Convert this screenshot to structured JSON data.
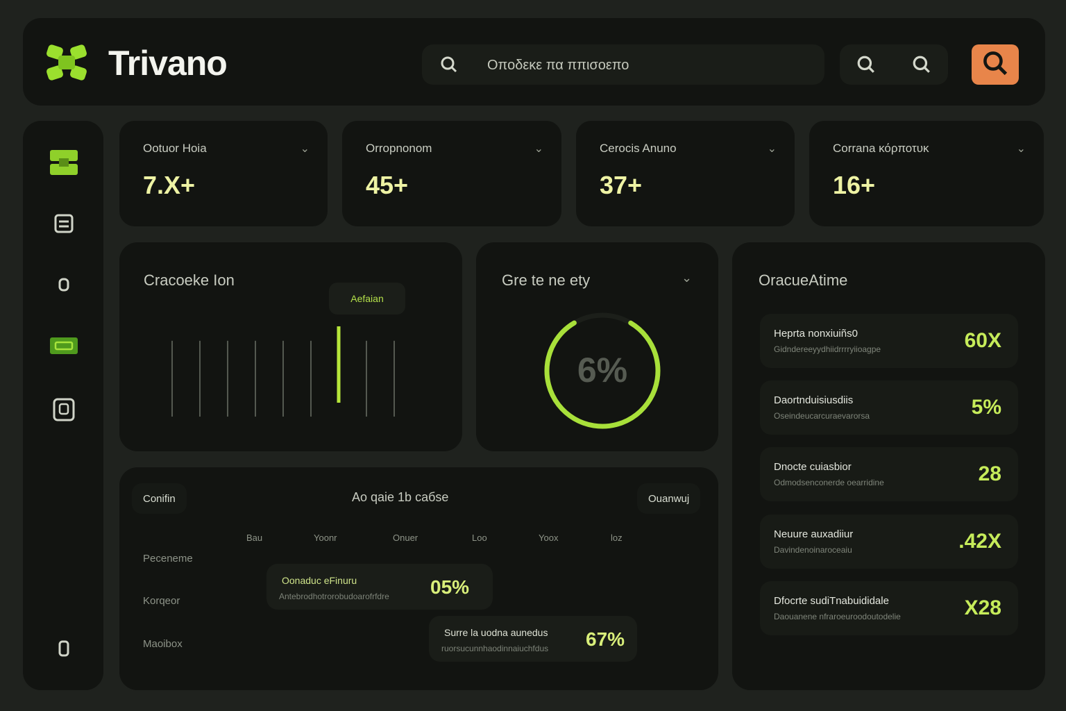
{
  "app": {
    "name": "Trivano"
  },
  "colors": {
    "accent": "#b6e63a",
    "highlight": "#e8854a",
    "panel": "#121411",
    "background": "#1f221e"
  },
  "search": {
    "placeholder": "Οποδεκε πα ππισοεπο"
  },
  "header_icons": [
    "search-icon",
    "search-icon",
    "search-icon"
  ],
  "sidebar": {
    "items": [
      {
        "icon": "grid-icon",
        "active": true
      },
      {
        "icon": "document-icon"
      },
      {
        "icon": "bell-icon"
      },
      {
        "icon": "card-icon"
      },
      {
        "icon": "tablet-icon"
      },
      {
        "icon": "user-icon"
      }
    ]
  },
  "stats": [
    {
      "label": "Ootuor Hoia",
      "value": "7.X+"
    },
    {
      "label": "Orropnonom",
      "value": "45+"
    },
    {
      "label": "Cerocis Anuno",
      "value": "37+"
    },
    {
      "label": "Corrana κόρποτυκ",
      "value": "16+"
    }
  ],
  "bar_chart": {
    "title": "Cracoeke Ion",
    "tooltip": "Aefaian",
    "levels": [
      0.78,
      0.78,
      0.78,
      0.78,
      0.78,
      0.78,
      1.0,
      0.78,
      0.78
    ],
    "highlight_index": 6
  },
  "gauge": {
    "title": "Gre te ne ety",
    "value_text": "6%",
    "progress": 0.83
  },
  "activity": {
    "title": "OracueAtime",
    "items": [
      {
        "title": "Heprta nonxiuiñs0",
        "subtitle": "Gidndereeyydhiidrrrryiioagpe",
        "value": "60X"
      },
      {
        "title": "Daortnduisiusdiis",
        "subtitle": "Oseindeucarcuraevarorsa",
        "value": "5%"
      },
      {
        "title": "Dnocte cuiasbior",
        "subtitle": "Odmodsenconerde oearridine",
        "value": "28"
      },
      {
        "title": "Neuure auxadiiur",
        "subtitle": "Davindenoinaroceaiu",
        "value": ".42X"
      },
      {
        "title": "Dfocrte sudiTnabuididale",
        "subtitle": "Daouanene nfraroeuroodoutodelie",
        "value": "X28"
      }
    ]
  },
  "table": {
    "left_pill": "Conifin",
    "title": "Ao qaie 1b caбse",
    "right_pill": "Ouanwuj",
    "columns": [
      "Bau",
      "Yoonr",
      "Onuer",
      "Loo",
      "Yoox",
      "loz"
    ],
    "rows": [
      "Peceneme",
      "Korqeor",
      "Maoibox"
    ],
    "highlights": [
      {
        "title": "Oonaduc eFinuru",
        "subtitle": "Antebrodhotrorobudoarofrfdre",
        "value": "05%"
      },
      {
        "title": "Surre la uodna aunedus",
        "subtitle": "ruorsucunnhaodinnaiuchfdus",
        "value": "67%"
      }
    ]
  }
}
